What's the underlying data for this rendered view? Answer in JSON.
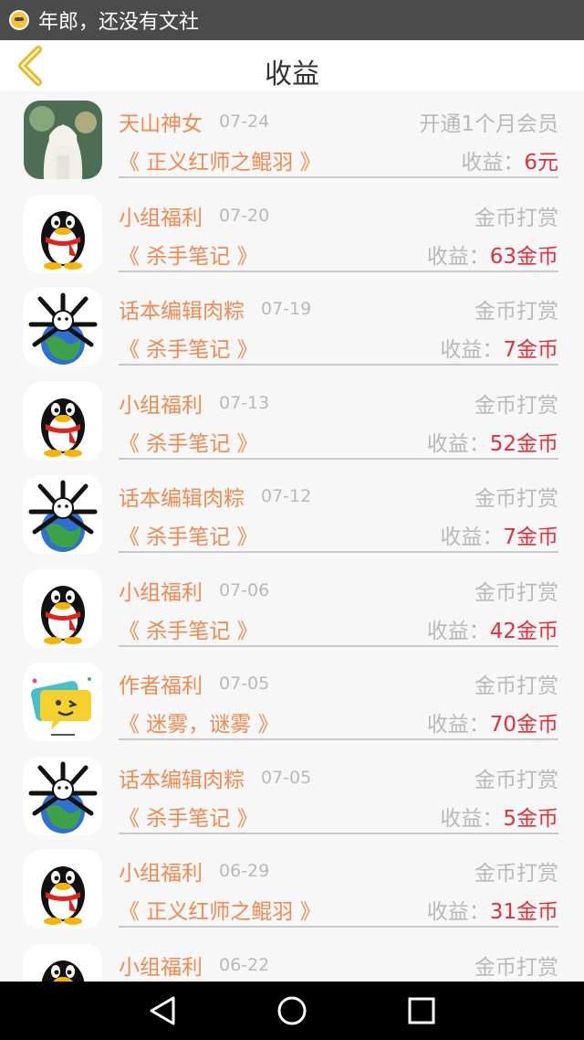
{
  "status_bar": {
    "text": "年郎，还没有文社"
  },
  "header": {
    "title": "收益"
  },
  "earn_label": "收益：",
  "items": [
    {
      "name": "天山神女",
      "date": "07-24",
      "type": "开通1个月会员",
      "book": "《 正义红师之鲲羽 》",
      "amount": "6元",
      "avatar": "anime"
    },
    {
      "name": "小组福利",
      "date": "07-20",
      "type": "金币打赏",
      "book": "《 杀手笔记 》",
      "amount": "63金币",
      "avatar": "penguin"
    },
    {
      "name": "话本编辑肉粽",
      "date": "07-19",
      "type": "金币打赏",
      "book": "《 杀手笔记 》",
      "amount": "7金币",
      "avatar": "globe"
    },
    {
      "name": "小组福利",
      "date": "07-13",
      "type": "金币打赏",
      "book": "《 杀手笔记 》",
      "amount": "52金币",
      "avatar": "penguin"
    },
    {
      "name": "话本编辑肉粽",
      "date": "07-12",
      "type": "金币打赏",
      "book": "《 杀手笔记 》",
      "amount": "7金币",
      "avatar": "globe"
    },
    {
      "name": "小组福利",
      "date": "07-06",
      "type": "金币打赏",
      "book": "《 杀手笔记 》",
      "amount": "42金币",
      "avatar": "penguin"
    },
    {
      "name": "作者福利",
      "date": "07-05",
      "type": "金币打赏",
      "book": "《 迷雾，谜雾 》",
      "amount": "70金币",
      "avatar": "smiley"
    },
    {
      "name": "话本编辑肉粽",
      "date": "07-05",
      "type": "金币打赏",
      "book": "《 杀手笔记 》",
      "amount": "5金币",
      "avatar": "globe"
    },
    {
      "name": "小组福利",
      "date": "06-29",
      "type": "金币打赏",
      "book": "《 正义红师之鲲羽 》",
      "amount": "31金币",
      "avatar": "penguin"
    },
    {
      "name": "小组福利",
      "date": "06-22",
      "type": "金币打赏",
      "book": "",
      "amount": "",
      "avatar": "penguin"
    }
  ],
  "colors": {
    "name_orange": "#f08a52",
    "amount_red": "#e0313b",
    "muted_gray": "#b9b9b9",
    "back_arrow": "#e8b72a"
  },
  "icons": {
    "back": "chevron-left-icon",
    "nav_back": "triangle-back-icon",
    "nav_home": "circle-home-icon",
    "nav_recents": "square-recents-icon"
  }
}
